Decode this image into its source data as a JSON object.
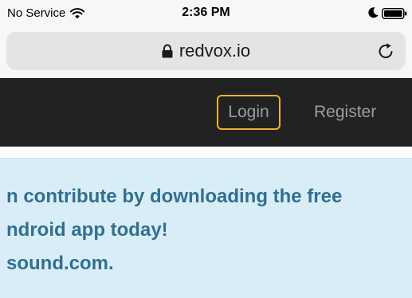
{
  "status_bar": {
    "carrier": "No Service",
    "time": "2:36 PM",
    "icons": [
      "wifi-icon",
      "moon-icon",
      "battery-icon"
    ]
  },
  "browser": {
    "url": "redvox.io",
    "icons": [
      "lock-icon",
      "reload-icon"
    ]
  },
  "navbar": {
    "login_label": "Login",
    "register_label": "Register",
    "background_color": "#222222",
    "login_outline_color": "#e8b520"
  },
  "alert": {
    "lines": [
      "n contribute by downloading the free",
      "ndroid app today!",
      "sound.com."
    ],
    "background_color": "#d9edf7",
    "text_color": "#31708f"
  }
}
